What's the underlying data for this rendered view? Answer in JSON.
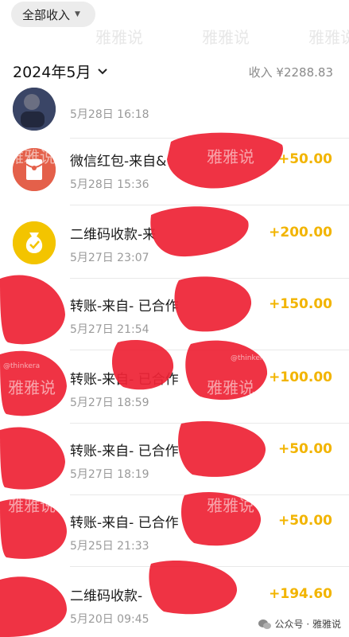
{
  "filter": {
    "label": "全部收入"
  },
  "header": {
    "month": "2024年5月",
    "income_summary": "收入 ¥2288.83"
  },
  "transactions": [
    {
      "title": "",
      "time": "5月28日 16:18",
      "amount": "",
      "avatar": "photo"
    },
    {
      "title": "微信红包-来自&",
      "time": "5月28日 15:36",
      "amount": "+50.00",
      "avatar": "red-packet"
    },
    {
      "title": "二维码收款-来",
      "time": "5月27日 23:07",
      "amount": "+200.00",
      "avatar": "money-bag"
    },
    {
      "title": "转账-来自- 已合作",
      "time": "5月27日 21:54",
      "amount": "+150.00",
      "avatar": "redacted"
    },
    {
      "title": "转账-来自- 已合作",
      "time": "5月27日 18:59",
      "amount": "+100.00",
      "avatar": "redacted"
    },
    {
      "title": "转账-来自- 已合作",
      "time": "5月27日 18:19",
      "amount": "+50.00",
      "avatar": "redacted"
    },
    {
      "title": "转账-来自- 已合作",
      "time": "5月25日 21:33",
      "amount": "+50.00",
      "avatar": "redacted"
    },
    {
      "title": "二维码收款-",
      "time": "5月20日 09:45",
      "amount": "+194.60",
      "avatar": "redacted"
    }
  ],
  "watermarks": {
    "text": "雅雅说",
    "handle": "@thinkera"
  },
  "footer": {
    "label": "公众号 · 雅雅说"
  },
  "colors": {
    "amount": "#f2b400",
    "redaction": "#ee2436",
    "red_packet": "#e4604a",
    "money_bag": "#f3c400"
  }
}
